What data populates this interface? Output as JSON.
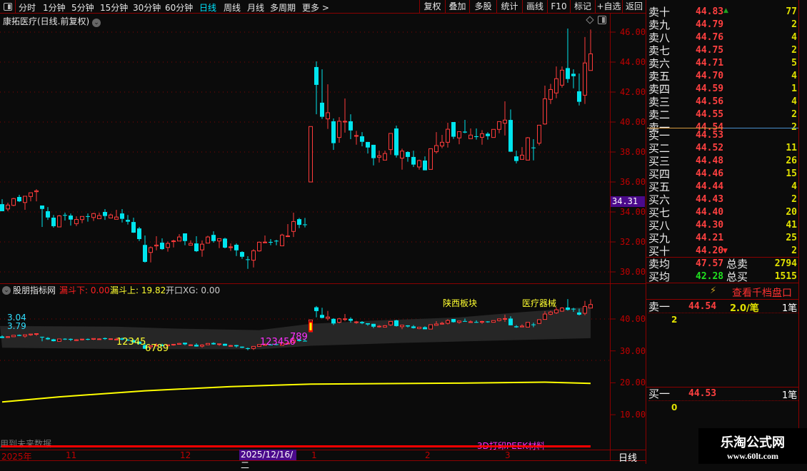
{
  "toolbar": {
    "periods": [
      "分时",
      "1分钟",
      "5分钟",
      "15分钟",
      "30分钟",
      "60分钟",
      "日线",
      "周线",
      "月线",
      "多周期",
      "更多 >"
    ],
    "active": "日线",
    "buttons": [
      "复权",
      "叠加",
      "多股",
      "统计",
      "画线",
      "F10",
      "标记",
      "+自选",
      "返回"
    ]
  },
  "chart": {
    "title": "康拓医疗(日线.前复权)",
    "price_label": "34.31",
    "axis_ticks": [
      "46.00",
      "44.00",
      "42.00",
      "40.00",
      "38.00",
      "36.00",
      "34.00",
      "32.00",
      "30.00"
    ],
    "colors": {
      "up": "#ff3b3b",
      "down": "#00e5ee",
      "grid": "#8b0000"
    },
    "ohlc": [
      [
        34.52,
        34.85,
        34.05,
        34.05
      ],
      [
        34.2,
        34.62,
        34.05,
        34.46
      ],
      [
        34.44,
        34.94,
        34.38,
        34.89
      ],
      [
        35.0,
        35.14,
        34.66,
        34.71
      ],
      [
        34.63,
        35.05,
        34.14,
        35.05
      ],
      [
        35.03,
        35.28,
        34.71,
        35.28
      ],
      [
        35.35,
        35.52,
        34.71,
        35.41
      ],
      [
        34.43,
        34.43,
        33.0,
        34.2
      ],
      [
        34.05,
        34.33,
        33.47,
        33.63
      ],
      [
        33.62,
        33.8,
        32.95,
        33.05
      ],
      [
        33.0,
        33.79,
        33.0,
        33.74
      ],
      [
        33.8,
        33.95,
        33.43,
        33.76
      ],
      [
        33.76,
        33.89,
        33.09,
        33.49
      ],
      [
        33.22,
        33.71,
        33.06,
        33.5
      ],
      [
        33.49,
        33.7,
        33.25,
        33.7
      ],
      [
        33.72,
        33.9,
        33.35,
        33.68
      ],
      [
        33.63,
        33.94,
        33.4,
        33.89
      ],
      [
        33.55,
        33.95,
        33.55,
        33.76
      ],
      [
        34.0,
        34.19,
        33.47,
        33.73
      ],
      [
        33.6,
        33.89,
        33.6,
        33.8
      ],
      [
        33.51,
        34.14,
        33.5,
        33.66
      ],
      [
        33.9,
        34.19,
        33.3,
        33.54
      ],
      [
        33.47,
        33.8,
        33.16,
        33.35
      ],
      [
        33.33,
        33.62,
        32.6,
        32.62
      ],
      [
        32.9,
        33.0,
        32.06,
        32.19
      ],
      [
        31.8,
        32.43,
        30.62,
        30.67
      ],
      [
        31.3,
        31.7,
        30.63,
        31.62
      ],
      [
        31.73,
        32.38,
        31.44,
        31.79
      ],
      [
        31.95,
        32.24,
        31.47,
        31.52
      ],
      [
        31.63,
        32.03,
        31.35,
        31.9
      ],
      [
        32.02,
        32.15,
        31.63,
        32.07
      ],
      [
        32.06,
        32.52,
        32.06,
        32.33
      ],
      [
        32.57,
        32.57,
        31.78,
        32.06
      ],
      [
        31.78,
        32.1,
        31.78,
        31.9
      ],
      [
        31.9,
        32.38,
        31.33,
        31.38
      ],
      [
        31.47,
        32.1,
        31.01,
        31.85
      ],
      [
        31.92,
        32.41,
        31.92,
        32.33
      ],
      [
        32.47,
        32.71,
        31.95,
        32.06
      ],
      [
        32.06,
        32.22,
        31.59,
        32.22
      ],
      [
        32.22,
        32.28,
        31.57,
        31.62
      ],
      [
        31.62,
        31.9,
        31.4,
        31.67
      ],
      [
        31.81,
        31.9,
        31.06,
        31.44
      ],
      [
        31.33,
        31.38,
        30.87,
        31.01
      ],
      [
        30.84,
        31.05,
        30.2,
        30.82
      ],
      [
        30.78,
        31.52,
        30.3,
        31.41
      ],
      [
        31.4,
        32.03,
        31.35,
        31.98
      ],
      [
        31.97,
        32.43,
        31.92,
        31.99
      ],
      [
        32.0,
        32.19,
        31.78,
        31.96
      ],
      [
        32.08,
        32.14,
        31.78,
        32.04
      ],
      [
        31.74,
        32.55,
        31.74,
        32.46
      ],
      [
        32.37,
        33.19,
        32.33,
        32.4
      ],
      [
        32.7,
        33.95,
        32.33,
        33.36
      ],
      [
        33.52,
        33.6,
        32.92,
        33.14
      ],
      [
        33.17,
        33.6,
        32.97,
        33.13
      ],
      [
        36.0,
        39.7,
        36.0,
        39.7
      ],
      [
        43.67,
        44.05,
        40.52,
        42.48
      ],
      [
        41.29,
        43.52,
        40.21,
        40.35
      ],
      [
        40.21,
        42.52,
        39.54,
        40.62
      ],
      [
        40.05,
        40.24,
        38.14,
        38.59
      ],
      [
        38.97,
        40.33,
        38.62,
        40.05
      ],
      [
        40.0,
        41.57,
        39.29,
        40.05
      ],
      [
        40.05,
        40.52,
        38.86,
        39.44
      ],
      [
        39.05,
        39.41,
        38.49,
        39.1
      ],
      [
        39.05,
        39.33,
        38.38,
        38.68
      ],
      [
        38.67,
        38.67,
        37.9,
        38.3
      ],
      [
        38.48,
        38.48,
        37.11,
        37.59
      ],
      [
        37.65,
        38.09,
        37.3,
        37.75
      ],
      [
        37.46,
        38.09,
        37.46,
        37.9
      ],
      [
        38.16,
        39.24,
        37.82,
        39.24
      ],
      [
        39.57,
        39.76,
        37.63,
        37.78
      ],
      [
        37.59,
        38.22,
        36.82,
        38.06
      ],
      [
        38.0,
        38.05,
        37.35,
        37.67
      ],
      [
        37.67,
        38.09,
        37.0,
        37.16
      ],
      [
        37.0,
        37.49,
        36.82,
        37.43
      ],
      [
        37.43,
        37.71,
        36.78,
        36.78
      ],
      [
        36.84,
        38.22,
        36.84,
        38.22
      ],
      [
        38.02,
        39.33,
        37.9,
        38.43
      ],
      [
        38.4,
        39.14,
        38.25,
        38.65
      ],
      [
        38.65,
        39.95,
        38.3,
        39.52
      ],
      [
        40.0,
        40.0,
        38.87,
        39.02
      ],
      [
        38.94,
        39.36,
        38.52,
        39.36
      ],
      [
        39.36,
        40.14,
        39.25,
        39.3
      ],
      [
        38.89,
        39.57,
        38.89,
        39.13
      ],
      [
        39.05,
        39.57,
        38.83,
        39.0
      ],
      [
        38.98,
        39.46,
        38.49,
        39.22
      ],
      [
        39.22,
        39.32,
        38.83,
        39.06
      ],
      [
        38.97,
        39.51,
        38.97,
        39.51
      ],
      [
        39.51,
        40.03,
        39.25,
        40.03
      ],
      [
        39.92,
        41.38,
        39.1,
        40.13
      ],
      [
        40.14,
        40.84,
        38.02,
        38.02
      ],
      [
        37.71,
        38.09,
        37.24,
        37.4
      ],
      [
        37.51,
        38.33,
        37.51,
        37.79
      ],
      [
        37.46,
        39.0,
        37.46,
        38.95
      ],
      [
        38.3,
        38.86,
        37.44,
        38.28
      ],
      [
        38.59,
        39.79,
        38.44,
        39.79
      ],
      [
        39.87,
        42.43,
        39.82,
        41.55
      ],
      [
        41.51,
        42.55,
        41.2,
        42.17
      ],
      [
        41.94,
        43.71,
        41.59,
        42.89
      ],
      [
        42.46,
        43.71,
        42.3,
        43.46
      ],
      [
        43.6,
        46.24,
        42.62,
        42.87
      ],
      [
        43.22,
        43.52,
        42.25,
        43.06
      ],
      [
        42.05,
        43.24,
        41.11,
        41.35
      ],
      [
        41.79,
        45.67,
        41.21,
        43.94
      ],
      [
        43.44,
        46.17,
        43.44,
        44.55
      ]
    ]
  },
  "indicator": {
    "name": "股朋指标网",
    "lower_label": "漏斗下: 0.00",
    "upper_label": "漏斗上: 19.82",
    "xg_label": "开口XG: 0.00",
    "axis_ticks": [
      "40.00",
      "30.00",
      "20.00",
      "10.00"
    ],
    "left_values": [
      "3.04",
      "3.79"
    ],
    "seq1a": "12345",
    "seq1b": "6789",
    "seq2a": "123456",
    "seq2b": "789",
    "annotations": [
      "陕西板块",
      "医疗器械"
    ],
    "band_upper": [
      [
        0,
        37.8
      ],
      [
        20,
        37.6
      ],
      [
        30,
        37.0
      ],
      [
        45,
        36.5
      ],
      [
        54,
        38.5
      ],
      [
        65,
        39.5
      ],
      [
        80,
        40.5
      ],
      [
        90,
        42.0
      ],
      [
        103,
        43.8
      ]
    ],
    "band_lower": [
      [
        0,
        31.0
      ],
      [
        20,
        30.6
      ],
      [
        45,
        30.5
      ],
      [
        54,
        31.6
      ],
      [
        70,
        32.5
      ],
      [
        90,
        33.4
      ],
      [
        103,
        34.0
      ]
    ],
    "line": [
      [
        0,
        14.0
      ],
      [
        10,
        15.6
      ],
      [
        25,
        17.5
      ],
      [
        40,
        18.8
      ],
      [
        54,
        19.6
      ],
      [
        80,
        19.9
      ],
      [
        95,
        20.2
      ],
      [
        103,
        19.8
      ]
    ],
    "footer_left": "用到未来数据",
    "footer_tag": "3D打印PEEK材料"
  },
  "timeline": {
    "labels": [
      "2025年",
      "11",
      "12",
      "1",
      "2",
      "3"
    ],
    "cursor": "2025/12/16/二",
    "period": "日线"
  },
  "orderbook": {
    "asks": [
      {
        "l": "卖十",
        "p": "44.83",
        "v": "77"
      },
      {
        "l": "卖九",
        "p": "44.79",
        "v": "2"
      },
      {
        "l": "卖八",
        "p": "44.76",
        "v": "4"
      },
      {
        "l": "卖七",
        "p": "44.75",
        "v": "2"
      },
      {
        "l": "卖六",
        "p": "44.71",
        "v": "5"
      },
      {
        "l": "卖五",
        "p": "44.70",
        "v": "4"
      },
      {
        "l": "卖四",
        "p": "44.59",
        "v": "1"
      },
      {
        "l": "卖三",
        "p": "44.56",
        "v": "4"
      },
      {
        "l": "卖二",
        "p": "44.55",
        "v": "2"
      },
      {
        "l": "卖一",
        "p": "44.54",
        "v": "2"
      }
    ],
    "bids": [
      {
        "l": "买一",
        "p": "44.53",
        "v": ""
      },
      {
        "l": "买二",
        "p": "44.52",
        "v": "11"
      },
      {
        "l": "买三",
        "p": "44.48",
        "v": "26"
      },
      {
        "l": "买四",
        "p": "44.46",
        "v": "15"
      },
      {
        "l": "买五",
        "p": "44.44",
        "v": "4"
      },
      {
        "l": "买六",
        "p": "44.43",
        "v": "2"
      },
      {
        "l": "买七",
        "p": "44.40",
        "v": "20"
      },
      {
        "l": "买八",
        "p": "44.30",
        "v": "41"
      },
      {
        "l": "买九",
        "p": "44.21",
        "v": "25"
      },
      {
        "l": "买十",
        "p": "44.20",
        "v": "2"
      }
    ],
    "ask_avg_label": "卖均",
    "ask_avg": "47.57",
    "total_ask_label": "总卖",
    "total_ask": "2794",
    "bid_avg_label": "买均",
    "bid_avg": "42.28",
    "total_bid_label": "总买",
    "total_bid": "1515",
    "depth_link": "查看千档盘口",
    "queue_ask": {
      "l": "卖一",
      "p": "44.54",
      "avg": "2.0/笔",
      "count": "1笔",
      "first": "2"
    },
    "queue_bid": {
      "l": "买一",
      "p": "44.53",
      "count": "1笔",
      "first": "0"
    }
  },
  "watermark": {
    "name": "乐淘公式网",
    "url": "www.60lt.com"
  }
}
